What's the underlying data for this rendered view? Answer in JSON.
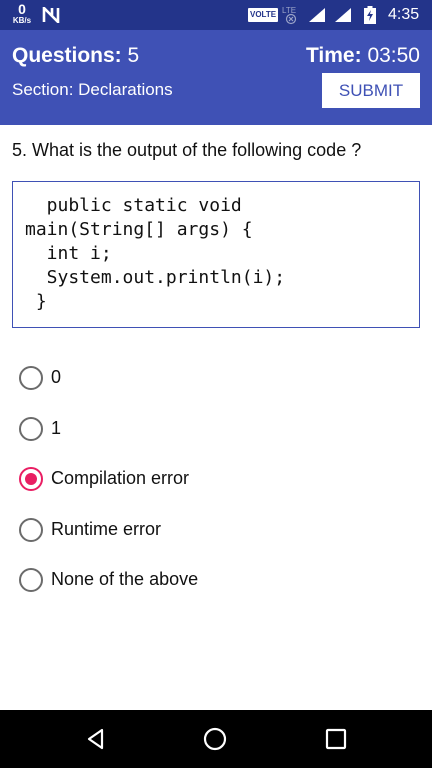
{
  "status_bar": {
    "net_speed_value": "0",
    "net_speed_unit": "KB/s",
    "volte_label": "VOLTE",
    "time": "4:35",
    "icons": [
      "n-icon",
      "lte-icon",
      "signal-icon",
      "signal-icon",
      "battery-charging-icon"
    ]
  },
  "header": {
    "questions_label": "Questions:",
    "questions_value": "5",
    "section_label": "Section: Declarations",
    "time_label": "Time:",
    "time_value": "03:50",
    "submit_label": "SUBMIT"
  },
  "question": {
    "text": "5. What is the output of the following code ?",
    "code": "  public static void\nmain(String[] args) {\n  int i;\n  System.out.println(i);\n }"
  },
  "options": [
    {
      "label": "0",
      "selected": false
    },
    {
      "label": "1",
      "selected": false
    },
    {
      "label": "Compilation error",
      "selected": true
    },
    {
      "label": "Runtime error",
      "selected": false
    },
    {
      "label": "None of the above",
      "selected": false
    }
  ],
  "nav_bar": {
    "icons": [
      "back-icon",
      "home-icon",
      "recents-icon"
    ]
  },
  "colors": {
    "status_bar": "#23348a",
    "primary": "#3f51b5",
    "accent": "#e91e63",
    "nav_bar": "#000000"
  }
}
